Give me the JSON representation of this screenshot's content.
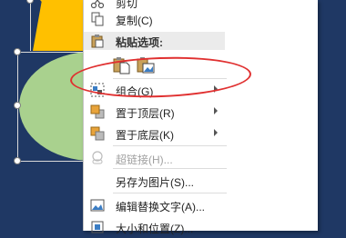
{
  "menu": {
    "cut_label": "剪切",
    "copy_label": "复制(C)",
    "paste_options_header": "粘贴选项:",
    "group_label": "组合(G)",
    "bring_front_label": "置于顶层(R)",
    "send_back_label": "置于底层(K)",
    "hyperlink_label": "超链接(H)...",
    "save_picture_label": "另存为图片(S)...",
    "alt_text_label": "编辑替换文字(A)...",
    "size_position_label": "大小和位置(Z)..."
  },
  "colors": {
    "slide_background": "#1f3864",
    "triangle": "#ffc000",
    "ellipse": "#a9d18e",
    "annotation_oval": "#e03030"
  },
  "icons": {
    "copy": "copy-icon",
    "paste_header": "clipboard-icon",
    "paste_keep_source": "paste-keep-source-icon",
    "paste_picture": "paste-picture-icon",
    "group": "group-icon",
    "bring_front": "bring-front-icon",
    "send_back": "send-back-icon",
    "hyperlink": "hyperlink-icon",
    "alt_text": "alt-text-icon",
    "size_position": "size-position-icon"
  }
}
